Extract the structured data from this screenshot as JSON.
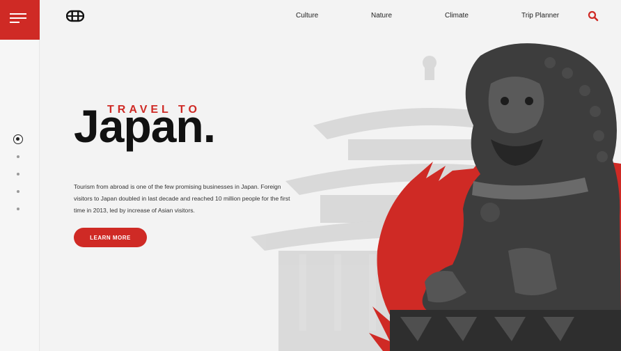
{
  "nav": {
    "links": [
      "Culture",
      "Nature",
      "Climate",
      "Trip Planner"
    ]
  },
  "hero": {
    "kicker": "TRAVEL TO",
    "title": "Japan.",
    "description": "Tourism from abroad is one of the few promising businesses in Japan. Foreign visitors to Japan doubled in last decade and reached 10 million people for the first time in 2013, led by increase of Asian visitors.",
    "cta_label": "LEARN MORE"
  },
  "slider": {
    "count": 5,
    "active_index": 0
  },
  "icons": {
    "menu": "hamburger-menu-icon",
    "logo": "torii-logo-icon",
    "search": "search-icon"
  },
  "colors": {
    "accent": "#cf2a25",
    "background": "#f3f3f3",
    "text": "#111111"
  }
}
